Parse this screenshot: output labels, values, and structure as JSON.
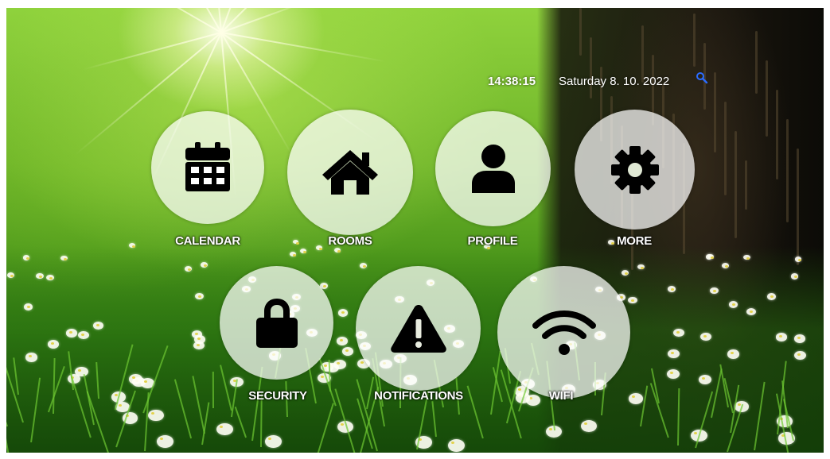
{
  "header": {
    "time": "14:38:15",
    "date": "Saturday 8. 10. 2022",
    "search_icon": "search-icon",
    "search_icon_color": "#2b6cff"
  },
  "tiles": [
    {
      "label": "CALENDAR",
      "icon": "calendar-icon"
    },
    {
      "label": "ROOMS",
      "icon": "house-icon"
    },
    {
      "label": "PROFILE",
      "icon": "user-icon"
    },
    {
      "label": "MORE",
      "icon": "gear-icon"
    },
    {
      "label": "SECURITY",
      "icon": "lock-icon"
    },
    {
      "label": "NOTIFICATIONS",
      "icon": "warning-icon"
    },
    {
      "label": "WIFI",
      "icon": "wifi-icon"
    }
  ],
  "theme": {
    "circle_fill": "#ffffffb8",
    "icon_color": "#000000",
    "label_color": "#ffffff"
  }
}
